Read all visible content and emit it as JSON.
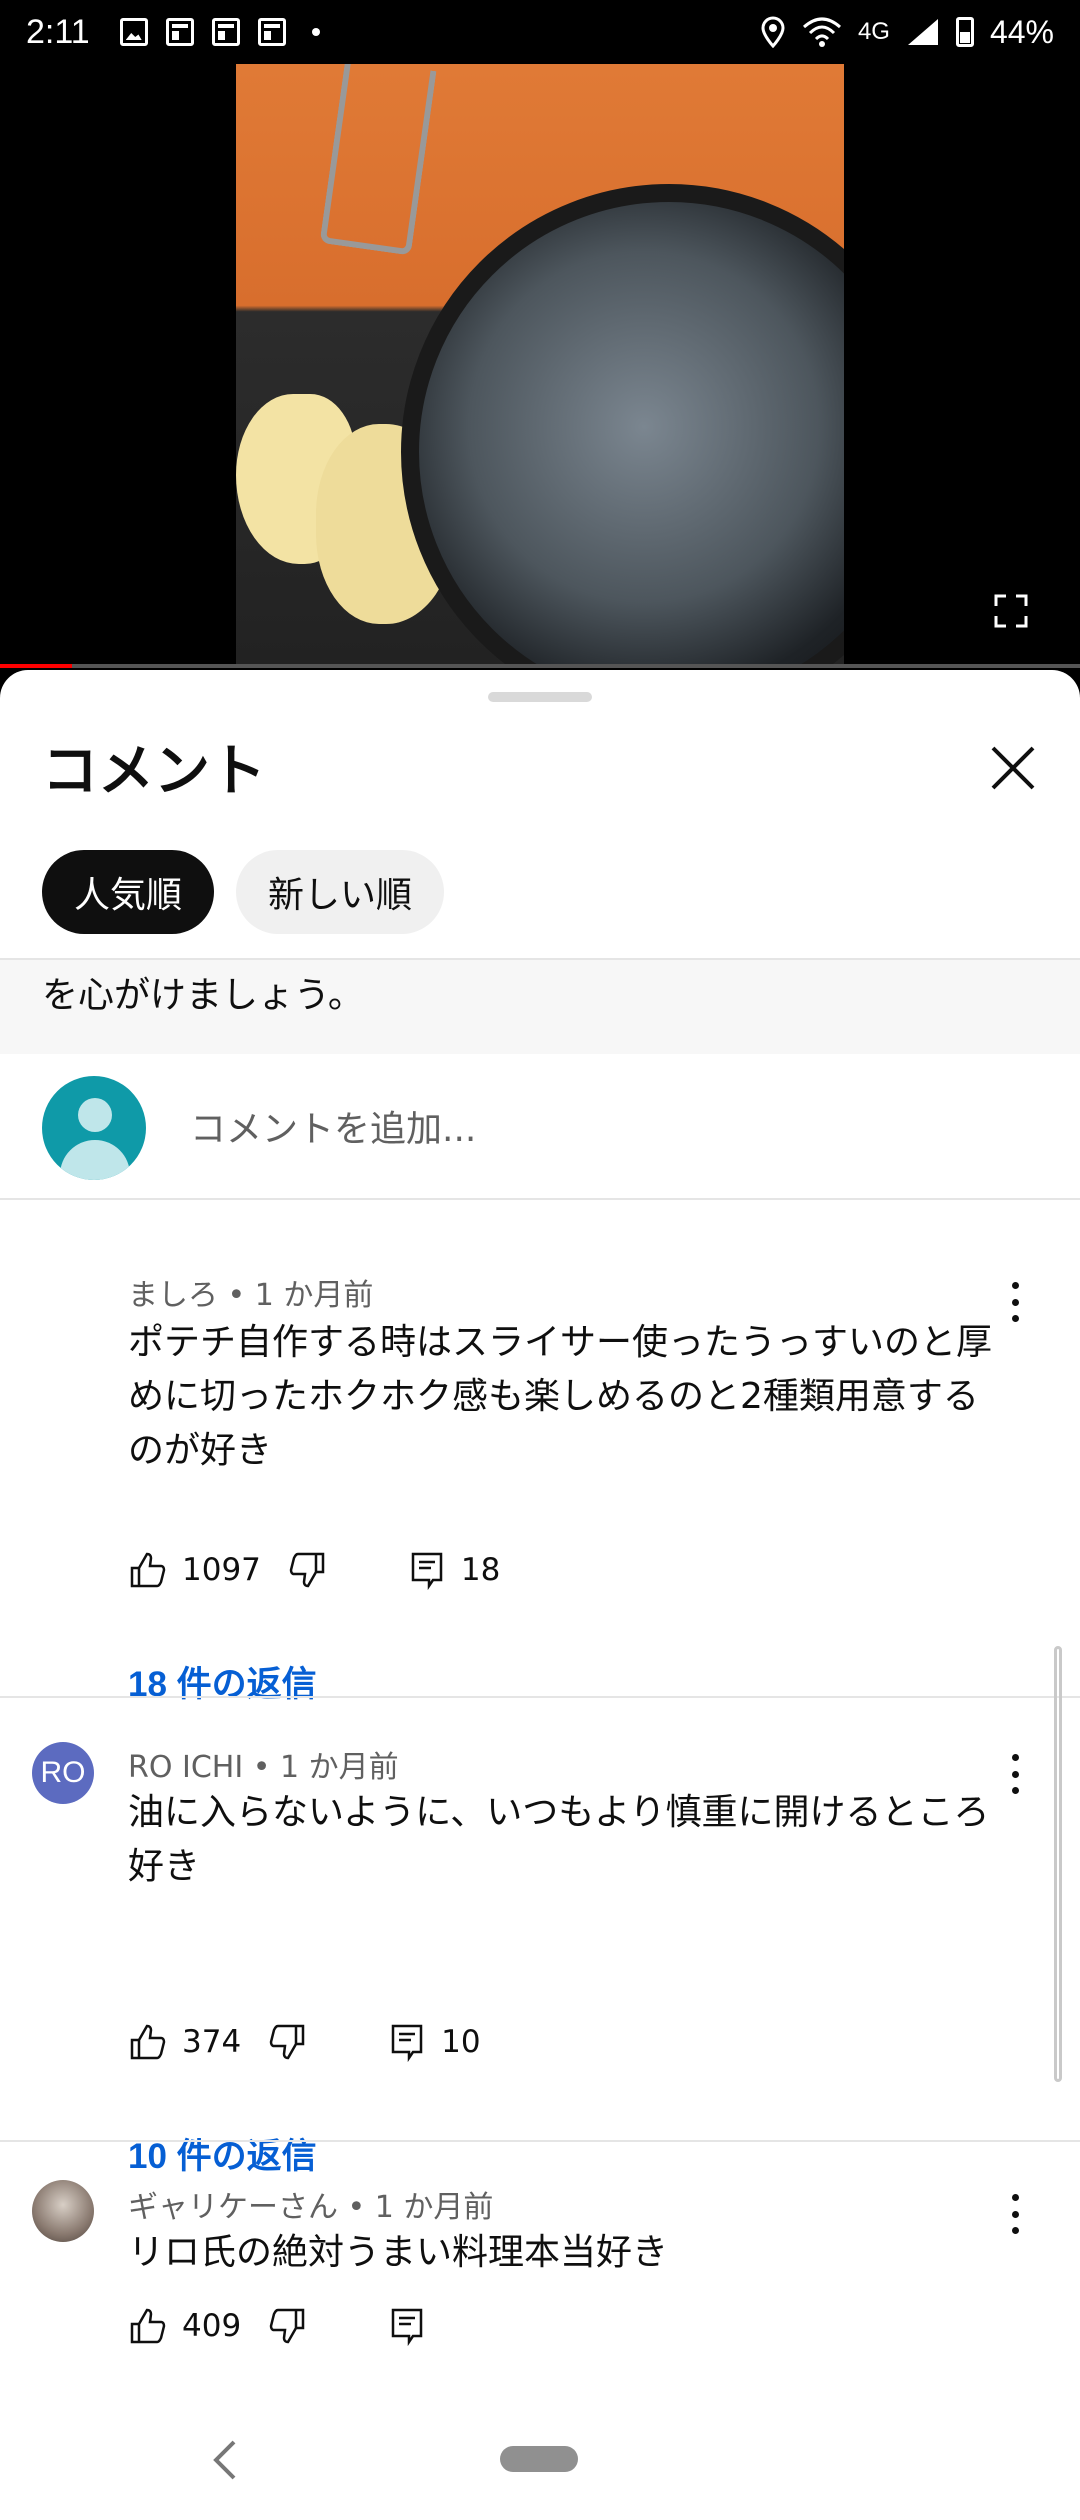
{
  "status_bar": {
    "time": "2:11",
    "network": "4G",
    "battery": "44%"
  },
  "sheet": {
    "title": "コメント",
    "chips": [
      "人気順",
      "新しい順"
    ],
    "notice_text": "を心がけましょう。",
    "add_comment_placeholder": "コメントを追加..."
  },
  "comments": [
    {
      "author": "ましろ",
      "time": "1 か月前",
      "meta": "ましろ • 1 か月前",
      "text": "ポテチ自作する時はスライサー使ったうっすいのと厚めに切ったホクホク感も楽しめるのと2種類用意するのが好き",
      "likes": "1097",
      "reply_count": "18",
      "replies_link": "18 件の返信",
      "avatar_text": "",
      "avatar_color": "#ffffff"
    },
    {
      "author": "RO ICHI",
      "time": "1 か月前",
      "meta": "RO ICHI • 1 か月前",
      "text": "油に入らないように、いつもより慎重に開けるところ好き",
      "likes": "374",
      "reply_count": "10",
      "replies_link": "10 件の返信",
      "avatar_text": "RO",
      "avatar_color": "#5c6bc0"
    },
    {
      "author": "ギャリケーさん",
      "time": "1 か月前",
      "meta": "ギャリケーさん • 1 か月前",
      "text": "リロ氏の絶対うまい料理本当好き",
      "likes": "409",
      "reply_count": "",
      "replies_link": "",
      "avatar_text": "",
      "avatar_color": "#8a7a70"
    }
  ]
}
